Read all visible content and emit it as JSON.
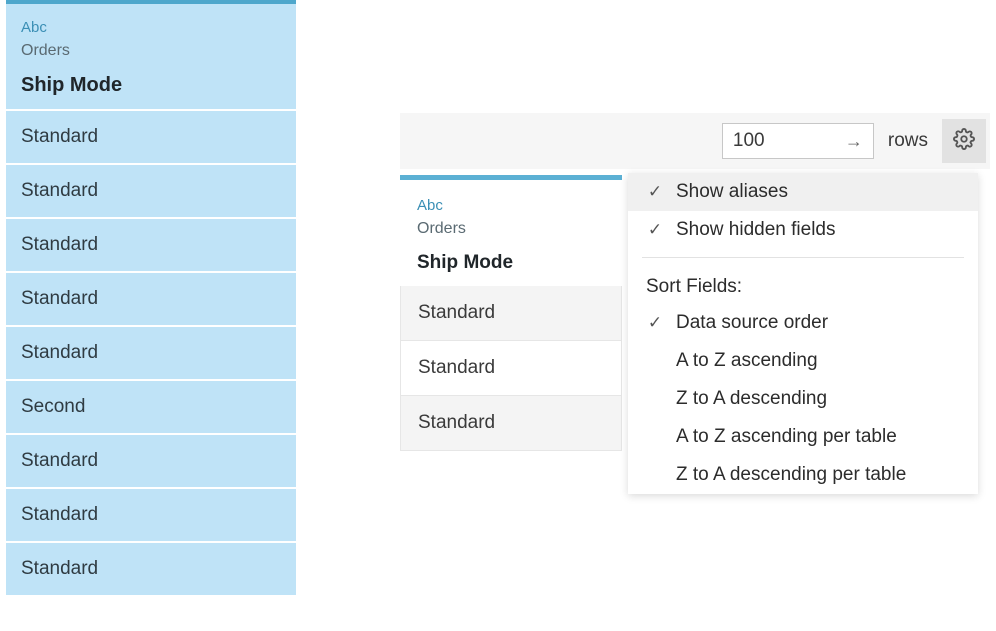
{
  "left_column": {
    "type_label": "Abc",
    "source_label": "Orders",
    "field_name": "Ship Mode",
    "rows": [
      "Standard",
      "Standard",
      "Standard",
      "Standard",
      "Standard",
      "Second",
      "Standard",
      "Standard",
      "Standard"
    ]
  },
  "control_bar": {
    "rows_input_value": "100",
    "rows_label": "rows"
  },
  "right_column": {
    "type_label": "Abc",
    "source_label": "Orders",
    "field_name": "Ship Mode",
    "rows": [
      "Standard",
      "Standard",
      "Standard"
    ]
  },
  "popover": {
    "show_aliases": "Show aliases",
    "show_hidden": "Show hidden fields",
    "sort_title": "Sort Fields:",
    "sort_options": {
      "data_source_order": "Data source order",
      "az_asc": "A to Z ascending",
      "za_desc": "Z to A descending",
      "az_asc_per_table": "A to Z ascending per table",
      "za_desc_per_table": "Z to A descending per table"
    }
  }
}
